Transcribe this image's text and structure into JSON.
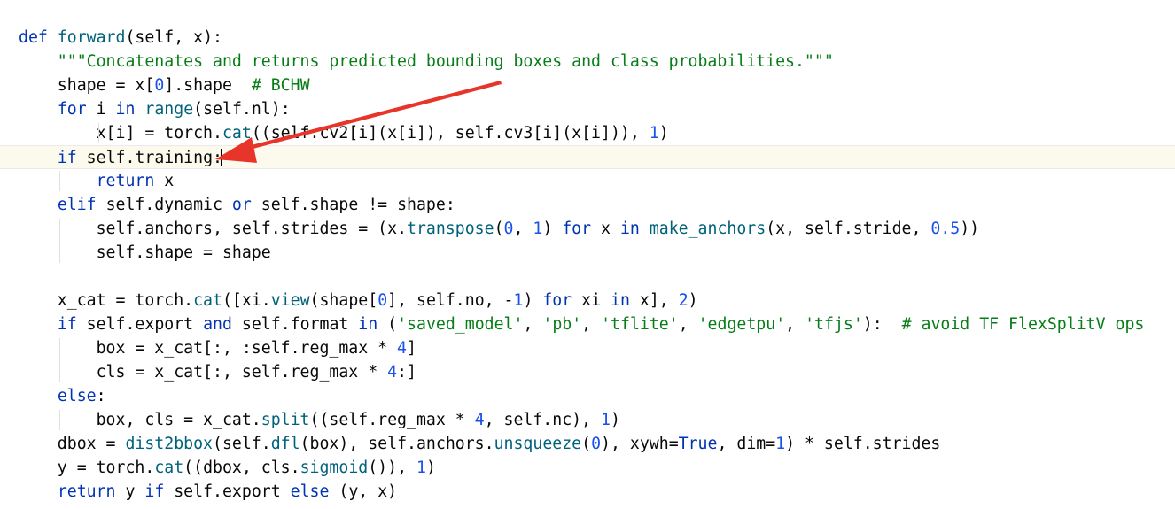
{
  "editor": {
    "lines": [
      [
        {
          "t": "def ",
          "c": "kw"
        },
        {
          "t": "forward",
          "c": "fn"
        },
        {
          "t": "(self, x):",
          "c": ""
        }
      ],
      [
        {
          "t": "    \"\"\"Concatenates and returns predicted bounding boxes and class probabilities.\"\"\"",
          "c": "doc"
        }
      ],
      [
        {
          "t": "    shape = x[",
          "c": ""
        },
        {
          "t": "0",
          "c": "num"
        },
        {
          "t": "].shape  ",
          "c": ""
        },
        {
          "t": "# BCHW",
          "c": "str"
        }
      ],
      [
        {
          "t": "    ",
          "c": ""
        },
        {
          "t": "for ",
          "c": "kw"
        },
        {
          "t": "i ",
          "c": ""
        },
        {
          "t": "in ",
          "c": "kw"
        },
        {
          "t": "range",
          "c": "fn"
        },
        {
          "t": "(self.nl):",
          "c": ""
        }
      ],
      [
        {
          "t": "        x[i] = torch.",
          "c": ""
        },
        {
          "t": "cat",
          "c": "fn"
        },
        {
          "t": "((self.cv2[i](x[i]), self.cv3[i](x[i])), ",
          "c": ""
        },
        {
          "t": "1",
          "c": "num"
        },
        {
          "t": ")",
          "c": ""
        }
      ],
      [
        {
          "t": "    ",
          "c": ""
        },
        {
          "t": "if ",
          "c": "kw"
        },
        {
          "t": "self.training:",
          "c": ""
        }
      ],
      [
        {
          "t": "        ",
          "c": ""
        },
        {
          "t": "return ",
          "c": "kw"
        },
        {
          "t": "x",
          "c": ""
        }
      ],
      [
        {
          "t": "    ",
          "c": ""
        },
        {
          "t": "elif ",
          "c": "kw"
        },
        {
          "t": "self.dynamic ",
          "c": ""
        },
        {
          "t": "or ",
          "c": "kw"
        },
        {
          "t": "self.shape != shape:",
          "c": ""
        }
      ],
      [
        {
          "t": "        self.anchors, self.strides = (x.",
          "c": ""
        },
        {
          "t": "transpose",
          "c": "fn"
        },
        {
          "t": "(",
          "c": ""
        },
        {
          "t": "0",
          "c": "num"
        },
        {
          "t": ", ",
          "c": ""
        },
        {
          "t": "1",
          "c": "num"
        },
        {
          "t": ") ",
          "c": ""
        },
        {
          "t": "for ",
          "c": "kw"
        },
        {
          "t": "x ",
          "c": ""
        },
        {
          "t": "in ",
          "c": "kw"
        },
        {
          "t": "make_anchors",
          "c": "fn"
        },
        {
          "t": "(x, self.stride, ",
          "c": ""
        },
        {
          "t": "0.5",
          "c": "num"
        },
        {
          "t": "))",
          "c": ""
        }
      ],
      [
        {
          "t": "        self.shape = shape",
          "c": ""
        }
      ],
      [
        {
          "t": "",
          "c": ""
        }
      ],
      [
        {
          "t": "    x_cat = torch.",
          "c": ""
        },
        {
          "t": "cat",
          "c": "fn"
        },
        {
          "t": "([xi.",
          "c": ""
        },
        {
          "t": "view",
          "c": "fn"
        },
        {
          "t": "(shape[",
          "c": ""
        },
        {
          "t": "0",
          "c": "num"
        },
        {
          "t": "], self.no, -",
          "c": ""
        },
        {
          "t": "1",
          "c": "num"
        },
        {
          "t": ") ",
          "c": ""
        },
        {
          "t": "for ",
          "c": "kw"
        },
        {
          "t": "xi ",
          "c": ""
        },
        {
          "t": "in ",
          "c": "kw"
        },
        {
          "t": "x], ",
          "c": ""
        },
        {
          "t": "2",
          "c": "num"
        },
        {
          "t": ")",
          "c": ""
        }
      ],
      [
        {
          "t": "    ",
          "c": ""
        },
        {
          "t": "if ",
          "c": "kw"
        },
        {
          "t": "self.export ",
          "c": ""
        },
        {
          "t": "and ",
          "c": "kw"
        },
        {
          "t": "self.format ",
          "c": ""
        },
        {
          "t": "in ",
          "c": "kw"
        },
        {
          "t": "(",
          "c": ""
        },
        {
          "t": "'saved_model'",
          "c": "str"
        },
        {
          "t": ", ",
          "c": ""
        },
        {
          "t": "'pb'",
          "c": "str"
        },
        {
          "t": ", ",
          "c": ""
        },
        {
          "t": "'tflite'",
          "c": "str"
        },
        {
          "t": ", ",
          "c": ""
        },
        {
          "t": "'edgetpu'",
          "c": "str"
        },
        {
          "t": ", ",
          "c": ""
        },
        {
          "t": "'tfjs'",
          "c": "str"
        },
        {
          "t": "):  ",
          "c": ""
        },
        {
          "t": "# avoid TF FlexSplitV ops",
          "c": "str"
        }
      ],
      [
        {
          "t": "        box = x_cat[:, :self.reg_max * ",
          "c": ""
        },
        {
          "t": "4",
          "c": "num"
        },
        {
          "t": "]",
          "c": ""
        }
      ],
      [
        {
          "t": "        cls = x_cat[:, self.reg_max * ",
          "c": ""
        },
        {
          "t": "4",
          "c": "num"
        },
        {
          "t": ":]",
          "c": ""
        }
      ],
      [
        {
          "t": "    ",
          "c": ""
        },
        {
          "t": "else",
          "c": "kw"
        },
        {
          "t": ":",
          "c": ""
        }
      ],
      [
        {
          "t": "        box, cls = x_cat.",
          "c": ""
        },
        {
          "t": "split",
          "c": "fn"
        },
        {
          "t": "((self.reg_max * ",
          "c": ""
        },
        {
          "t": "4",
          "c": "num"
        },
        {
          "t": ", self.nc), ",
          "c": ""
        },
        {
          "t": "1",
          "c": "num"
        },
        {
          "t": ")",
          "c": ""
        }
      ],
      [
        {
          "t": "    dbox = ",
          "c": ""
        },
        {
          "t": "dist2bbox",
          "c": "fn"
        },
        {
          "t": "(self.",
          "c": ""
        },
        {
          "t": "dfl",
          "c": "fn"
        },
        {
          "t": "(box), self.anchors.",
          "c": ""
        },
        {
          "t": "unsqueeze",
          "c": "fn"
        },
        {
          "t": "(",
          "c": ""
        },
        {
          "t": "0",
          "c": "num"
        },
        {
          "t": "), xywh=",
          "c": ""
        },
        {
          "t": "True",
          "c": "kw"
        },
        {
          "t": ", dim=",
          "c": ""
        },
        {
          "t": "1",
          "c": "num"
        },
        {
          "t": ") * self.strides",
          "c": ""
        }
      ],
      [
        {
          "t": "    y = torch.",
          "c": ""
        },
        {
          "t": "cat",
          "c": "fn"
        },
        {
          "t": "((dbox, cls.",
          "c": ""
        },
        {
          "t": "sigmoid",
          "c": "fn"
        },
        {
          "t": "()), ",
          "c": ""
        },
        {
          "t": "1",
          "c": "num"
        },
        {
          "t": ")",
          "c": ""
        }
      ],
      [
        {
          "t": "    ",
          "c": ""
        },
        {
          "t": "return ",
          "c": "kw"
        },
        {
          "t": "y ",
          "c": ""
        },
        {
          "t": "if ",
          "c": "kw"
        },
        {
          "t": "self.export ",
          "c": ""
        },
        {
          "t": "else ",
          "c": "kw"
        },
        {
          "t": "(y, x)",
          "c": ""
        }
      ]
    ],
    "current_line": 5,
    "colors": {
      "keyword": "#0033b3",
      "function": "#00627a",
      "string": "#067d17",
      "number": "#1750eb",
      "annotation_arrow": "#e8352a"
    }
  },
  "annotation": {
    "icon": "red-arrow-icon"
  }
}
